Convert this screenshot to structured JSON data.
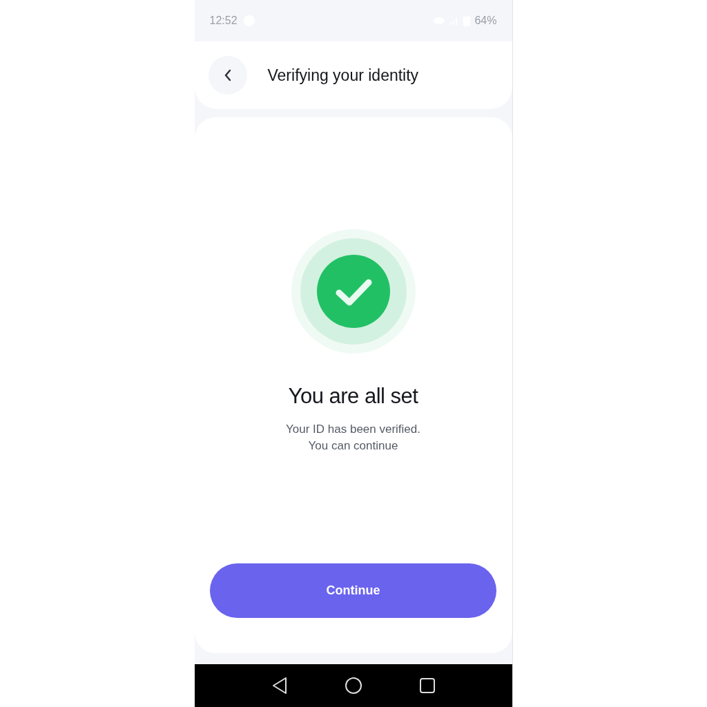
{
  "status_bar": {
    "time": "12:52",
    "battery": "64%"
  },
  "header": {
    "title": "Verifying your identity"
  },
  "result": {
    "kind": "success",
    "title": "You are all set",
    "message_lines": [
      "Your ID has been verified.",
      "You can continue"
    ]
  },
  "buttons": [
    {
      "label": "Continue"
    }
  ]
}
